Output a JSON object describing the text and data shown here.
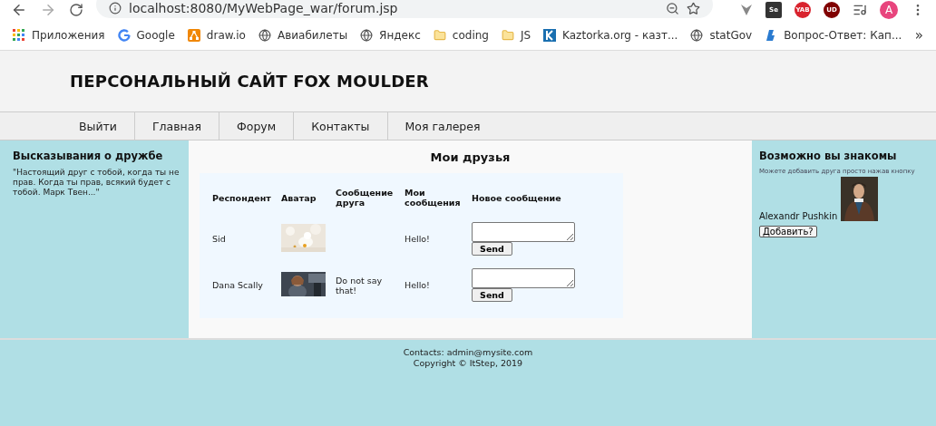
{
  "browser": {
    "address": "localhost:8080/MyWebPage_war/forum.jsp",
    "extensions": [
      {
        "kind": "vee"
      },
      {
        "kind": "badge",
        "label": "Se",
        "color": "#333333"
      },
      {
        "kind": "round",
        "label": "YAB",
        "color": "#d9232e"
      },
      {
        "kind": "shield",
        "label": "UD",
        "color": "#800000"
      }
    ],
    "profile": "A"
  },
  "bookmarks": [
    {
      "kind": "apps",
      "label": "Приложения"
    },
    {
      "kind": "google",
      "label": "Google"
    },
    {
      "kind": "drawio",
      "label": "draw.io"
    },
    {
      "kind": "globe",
      "label": "Авиабилеты"
    },
    {
      "kind": "globe",
      "label": "Яндекс"
    },
    {
      "kind": "folder",
      "label": "coding"
    },
    {
      "kind": "folder",
      "label": "JS"
    },
    {
      "kind": "k",
      "label": "Kaztorka.org - казт..."
    },
    {
      "kind": "globe",
      "label": "statGov"
    },
    {
      "kind": "b",
      "label": "Вопрос-Ответ: Кап..."
    }
  ],
  "bookmarks_more": "»",
  "site_title": "ПЕРСОНАЛЬНЫЙ САЙТ FOX MOULDER",
  "nav": [
    "Выйти",
    "Главная",
    "Форум",
    "Контакты",
    "Моя галерея"
  ],
  "left": {
    "title": "Высказывания о дружбе",
    "text": "\"Настоящий друг с тобой, когда ты не прав. Когда ты прав, всякий будет с тобой. Марк Твен...\""
  },
  "friends": {
    "title": "Мои друзья",
    "columns": [
      "Респондент",
      "Аватар",
      "Сообщение друга",
      "Мои сообщения",
      "Новое сообщение"
    ],
    "rows": [
      {
        "name": "Sid",
        "my_message": "Hello!",
        "button": "Send"
      },
      {
        "name": "Dana Scally",
        "friend_message": "Do not say that!",
        "my_message": "Hello!",
        "button": "Send"
      }
    ]
  },
  "right": {
    "title": "Возможно вы знакомы",
    "hint": "Можете добавить друга просто нажав кнопку",
    "name": "Alexandr Pushkin",
    "button": "Добавить?"
  },
  "footer": [
    "Contacts: admin@mysite.com",
    "Copyright © ItStep, 2019"
  ]
}
